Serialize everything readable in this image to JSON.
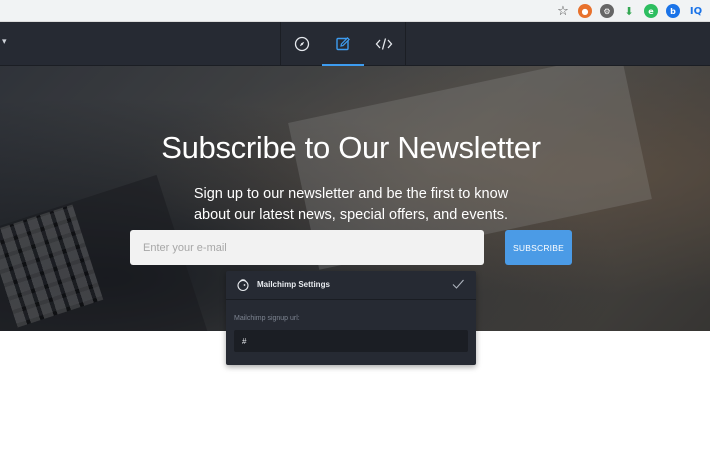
{
  "browser": {
    "extension_icons": [
      "star-icon",
      "orange-extension-icon",
      "gear-extension-icon",
      "green-download-icon",
      "evernote-icon",
      "blue-b-icon",
      "iq-icon"
    ],
    "iq_label": "IQ"
  },
  "toolbar": {
    "modes": [
      "compass-icon",
      "edit-icon",
      "code-icon"
    ],
    "active_mode": "edit-icon",
    "accent_color": "#3d9cf0"
  },
  "hero": {
    "title": "Subscribe to Our Newsletter",
    "subtitle": "Sign up to our newsletter and be the first to know about our latest news, special offers, and events.",
    "email_placeholder": "Enter your e-mail",
    "subscribe_label": "SUBSCRIBE",
    "button_color": "#4b9be6"
  },
  "mailchimp": {
    "title": "Mailchimp Settings",
    "field_label": "Mailchimp signup url:",
    "field_value": "#"
  }
}
